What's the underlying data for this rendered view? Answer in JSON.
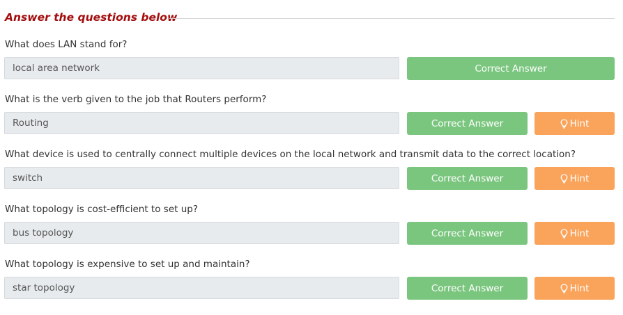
{
  "section": {
    "title": "Answer the questions below"
  },
  "questions": [
    {
      "question": "What does LAN stand for?",
      "answer": "local area network",
      "correct_label": "Correct Answer"
    },
    {
      "question": "What is the verb given to the job that Routers perform?",
      "answer": "Routing",
      "correct_label": "Correct Answer",
      "hint_label": "Hint"
    },
    {
      "question": "What device is used to centrally connect multiple devices on the local network and transmit data to the correct location?",
      "answer": "switch",
      "correct_label": "Correct Answer",
      "hint_label": "Hint"
    },
    {
      "question": "What topology is cost-efficient to set up?",
      "answer": "bus topology",
      "correct_label": "Correct Answer",
      "hint_label": "Hint"
    },
    {
      "question": "What topology is expensive to set up and maintain?",
      "answer": "star topology",
      "correct_label": "Correct Answer",
      "hint_label": "Hint"
    }
  ],
  "icons": {
    "hint": "lightbulb-icon"
  },
  "colors": {
    "title": "#a30e0e",
    "correct_button": "#7bc67f",
    "hint_button": "#f9a35b",
    "answer_field": "#e8ebee"
  }
}
